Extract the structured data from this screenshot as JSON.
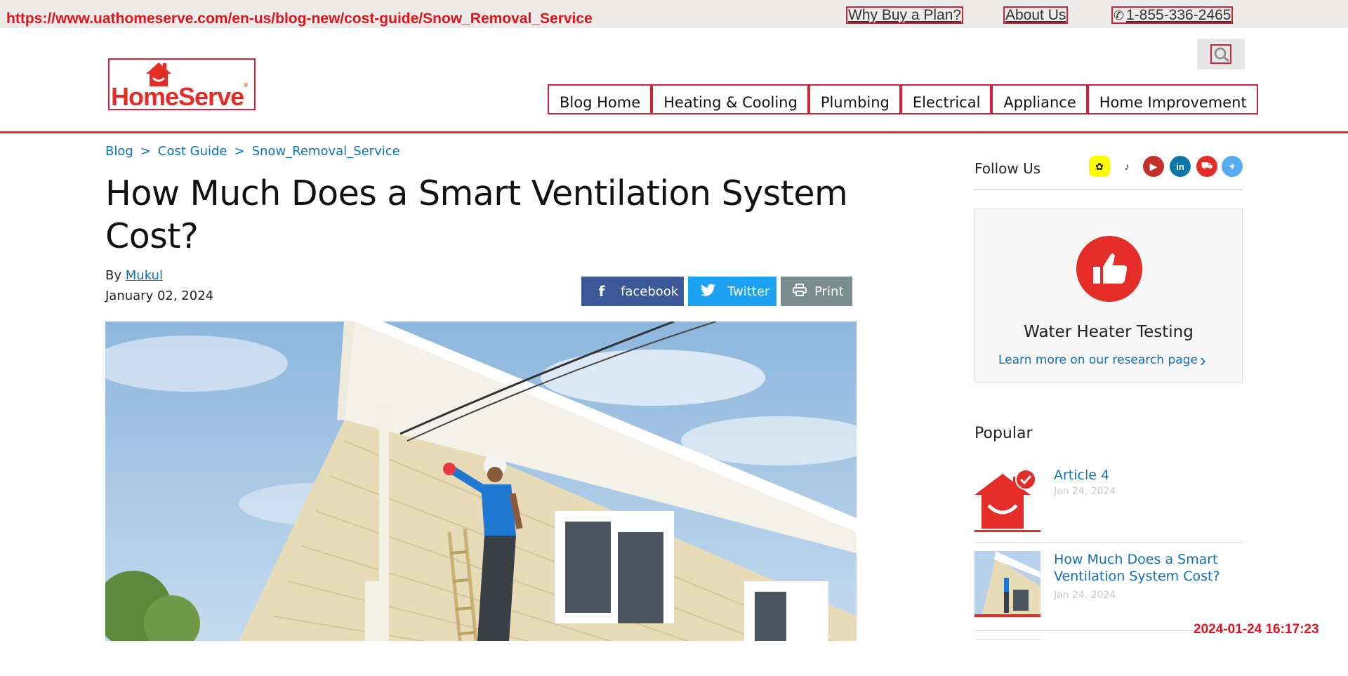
{
  "overlay": {
    "url": "https://www.uathomeserve.com/en-us/blog-new/cost-guide/Snow_Removal_Service",
    "timestamp": "2024-01-24 16:17:23"
  },
  "utility": {
    "why_buy": "Why Buy a Plan?",
    "about": "About Us",
    "phone": "1-855-336-2465"
  },
  "brand": {
    "name": "HomeServe",
    "accent": "#e52d27",
    "link": "#1070b8"
  },
  "nav": {
    "items": [
      "Blog Home",
      "Heating & Cooling",
      "Plumbing",
      "Electrical",
      "Appliance",
      "Home Improvement"
    ]
  },
  "breadcrumb": [
    "Blog",
    "Cost Guide",
    "Snow_Removal_Service"
  ],
  "article": {
    "title": "How Much Does a Smart Ventilation System Cost?",
    "by": "By",
    "author": "Mukul",
    "date": "January 02, 2024"
  },
  "share": {
    "facebook": "facebook",
    "twitter": "Twitter",
    "print": "Print"
  },
  "sidebar": {
    "follow_label": "Follow Us",
    "social_icons": [
      "snapchat-icon",
      "tiktok-icon",
      "youtube-icon",
      "linkedin-icon",
      "truck-icon",
      "twitter-icon"
    ],
    "card": {
      "title": "Water Heater Testing",
      "link": "Learn more on our research page"
    },
    "popular_title": "Popular",
    "popular": [
      {
        "title": "Article 4",
        "date": "Jan 24, 2024"
      },
      {
        "title": "How Much Does a Smart Ventilation System Cost?",
        "date": "Jan 24, 2024"
      }
    ]
  }
}
